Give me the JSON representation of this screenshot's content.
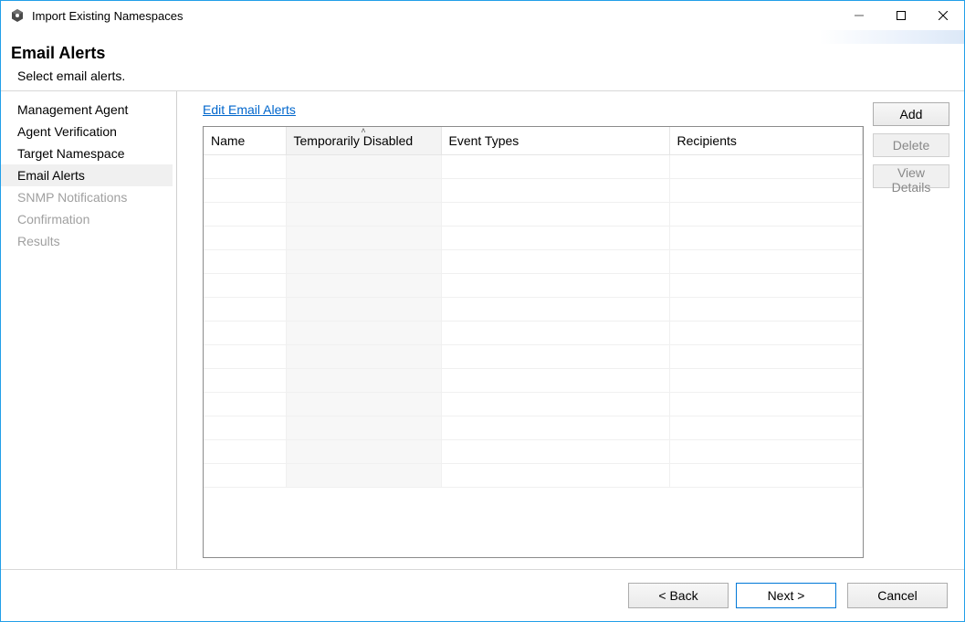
{
  "window": {
    "title": "Import Existing Namespaces"
  },
  "header": {
    "page_title": "Email Alerts",
    "subtitle": "Select email alerts."
  },
  "sidebar": {
    "items": [
      {
        "label": "Management Agent",
        "state": "done"
      },
      {
        "label": "Agent Verification",
        "state": "done"
      },
      {
        "label": "Target Namespace",
        "state": "done"
      },
      {
        "label": "Email Alerts",
        "state": "current"
      },
      {
        "label": "SNMP Notifications",
        "state": "disabled"
      },
      {
        "label": "Confirmation",
        "state": "disabled"
      },
      {
        "label": "Results",
        "state": "disabled"
      }
    ]
  },
  "main": {
    "edit_link": "Edit Email Alerts",
    "columns": [
      {
        "label": "Name"
      },
      {
        "label": "Temporarily Disabled",
        "sorted": "asc"
      },
      {
        "label": "Event Types"
      },
      {
        "label": "Recipients"
      }
    ],
    "rows": [],
    "placeholder_row_count": 14,
    "buttons": {
      "add": "Add",
      "delete": "Delete",
      "view_details": "View Details"
    }
  },
  "footer": {
    "back": "< Back",
    "next": "Next >",
    "cancel": "Cancel"
  }
}
